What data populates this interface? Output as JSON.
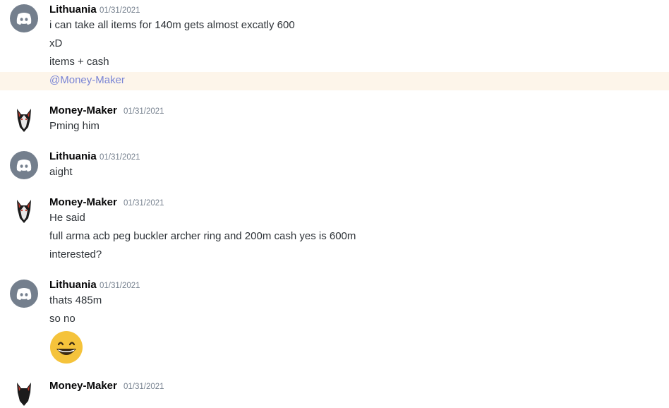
{
  "messages": [
    {
      "author": "Lithuania",
      "timestamp": "01/31/2021",
      "avatar": "discord-default-avatar",
      "lines": [
        "i can take all items for 140m gets almost excatly 600",
        "xD",
        "items + cash"
      ],
      "mention": "@Money-Maker"
    },
    {
      "author": "Money-Maker",
      "timestamp": "01/31/2021",
      "avatar": "wolf-avatar",
      "lines": [
        "Pming him"
      ]
    },
    {
      "author": "Lithuania",
      "timestamp": "01/31/2021",
      "avatar": "discord-default-avatar",
      "lines": [
        "aight"
      ]
    },
    {
      "author": "Money-Maker",
      "timestamp": "01/31/2021",
      "avatar": "wolf-avatar",
      "lines": [
        "He said",
        "full arma acb peg buckler archer ring and 200m cash yes is 600m",
        "interested?"
      ]
    },
    {
      "author": "Lithuania",
      "timestamp": "01/31/2021",
      "avatar": "discord-default-avatar",
      "lines": [
        "thats 485m",
        "so no"
      ],
      "emoji": "grinning-smile-emoji"
    },
    {
      "author": "Money-Maker",
      "timestamp": "01/31/2021",
      "avatar": "wolf-avatar",
      "lines": []
    }
  ],
  "colors": {
    "mention_highlight": "#fdf5ea",
    "mention_text": "#7984d5",
    "discord_avatar": "#747f8d",
    "username": "#060607",
    "timestamp": "#747f8d"
  }
}
